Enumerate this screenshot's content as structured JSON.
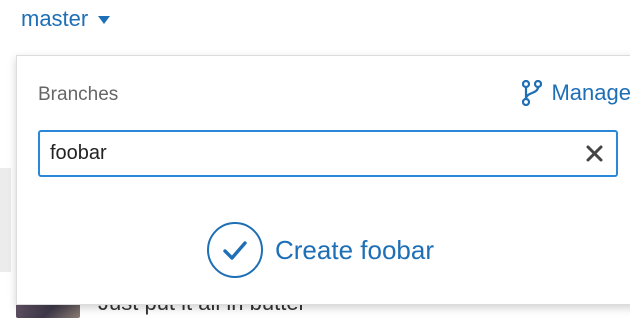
{
  "branch_picker": {
    "current_branch": "master",
    "caret_icon": "caret-down-icon"
  },
  "branch_dropdown": {
    "title": "Branches",
    "manage": {
      "label": "Manage",
      "icon": "branch-fork-icon"
    },
    "search": {
      "value": "foobar",
      "clear_icon": "close-icon"
    },
    "create": {
      "label": "Create foobar",
      "icon": "checkmark-circle-icon"
    }
  },
  "background": {
    "commit_text": "Just put it all in butter"
  },
  "colors": {
    "accent": "#1e6fb6",
    "focus_border": "#2b88d8",
    "muted_text": "#666666"
  }
}
